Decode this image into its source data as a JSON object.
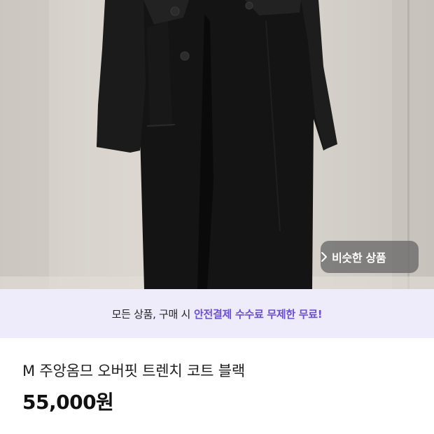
{
  "product_image": {
    "alt_icon": "black-trench-coat-photo"
  },
  "similar_button": {
    "label": "비슷한 상품",
    "icon": "chevron-right-icon"
  },
  "banner": {
    "prefix": "모든 상품, 구매 시",
    "highlight": "안전결제 수수료 무제한 무료!",
    "highlight_color": "#6a4fd8",
    "background": "#eeecfb"
  },
  "product": {
    "title": "M 주앙옴므 오버핏 트렌치 코트 블랙",
    "price": "55,000원"
  }
}
